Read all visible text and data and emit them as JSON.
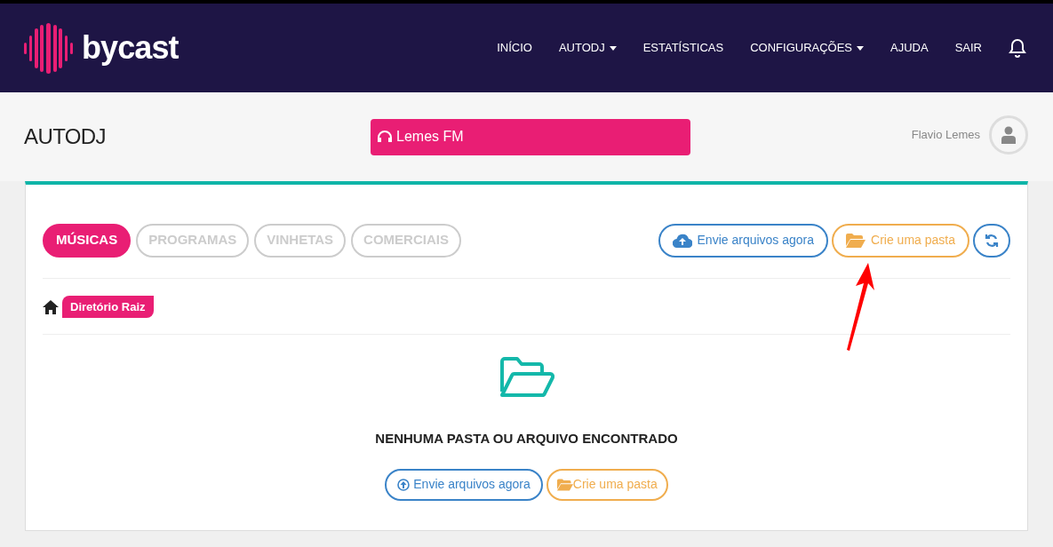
{
  "brand": {
    "name": "bycast"
  },
  "nav": [
    {
      "label": "INÍCIO",
      "dropdown": false
    },
    {
      "label": "AUTODJ",
      "dropdown": true
    },
    {
      "label": "ESTATÍSTICAS",
      "dropdown": false
    },
    {
      "label": "CONFIGURAÇÕES",
      "dropdown": true
    },
    {
      "label": "AJUDA",
      "dropdown": false
    },
    {
      "label": "SAIR",
      "dropdown": false
    }
  ],
  "page": {
    "title": "AUTODJ",
    "station": "Lemes FM",
    "user": "Flavio Lemes"
  },
  "tabs": [
    {
      "label": "MÚSICAS",
      "selected": true
    },
    {
      "label": "PROGRAMAS",
      "selected": false
    },
    {
      "label": "VINHETAS",
      "selected": false
    },
    {
      "label": "COMERCIAIS",
      "selected": false
    }
  ],
  "actions": {
    "upload": "Envie arquivos agora",
    "create_folder": "Crie uma pasta"
  },
  "breadcrumb": "Diretório Raiz",
  "empty": {
    "message": "NENHUMA PASTA OU ARQUIVO ENCONTRADO",
    "upload": "Envie arquivos agora",
    "create_folder": "Crie uma pasta"
  }
}
